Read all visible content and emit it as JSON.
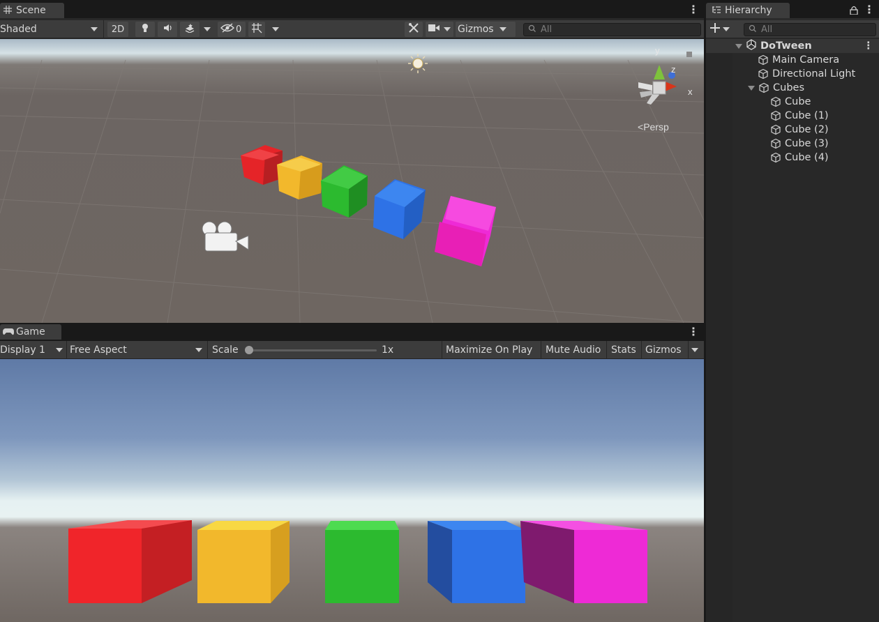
{
  "scene": {
    "tab_label": "Scene",
    "shading_mode": "Shaded",
    "btn_2d": "2D",
    "hidden_count": "0",
    "gizmos_label": "Gizmos",
    "search_placeholder": "All",
    "axis_labels": {
      "y": "y",
      "z": "z",
      "x": "x"
    },
    "persp_label": "Persp",
    "icons": [
      "grid-icon",
      "light-icon",
      "audio-icon",
      "effects-icon",
      "visibility-icon",
      "grid-snap-icon",
      "tools-icon",
      "camera-icon",
      "scene-gizmo-icon",
      "sun-icon",
      "camera-gizmo-icon"
    ]
  },
  "game": {
    "tab_label": "Game",
    "display": "Display 1",
    "aspect": "Free Aspect",
    "scale_label": "Scale",
    "scale_value": "1x",
    "scale_slider_fraction": 0,
    "maximize_on_play": "Maximize On Play",
    "mute_audio": "Mute Audio",
    "stats": "Stats",
    "gizmos": "Gizmos",
    "icons": [
      "gamepad-icon"
    ]
  },
  "hierarchy": {
    "tab_label": "Hierarchy",
    "search_placeholder": "All",
    "scene_name": "DoTween",
    "items": [
      {
        "label": "Main Camera"
      },
      {
        "label": "Directional Light"
      },
      {
        "label": "Cubes"
      },
      {
        "label": "Cube"
      },
      {
        "label": "Cube (1)"
      },
      {
        "label": "Cube (2)"
      },
      {
        "label": "Cube (3)"
      },
      {
        "label": "Cube (4)"
      }
    ],
    "icons": [
      "hierarchy-icon",
      "lock-icon",
      "add-icon",
      "unity-logo-icon",
      "gameobject-icon"
    ]
  },
  "colors": {
    "red": "#e52428",
    "yellow": "#f2b82c",
    "green": "#2cba2f",
    "blue": "#2e72e6",
    "magenta": "#ee2ad6",
    "editor_bg": "#282828",
    "toolbar_bg": "#3c3c3c"
  }
}
